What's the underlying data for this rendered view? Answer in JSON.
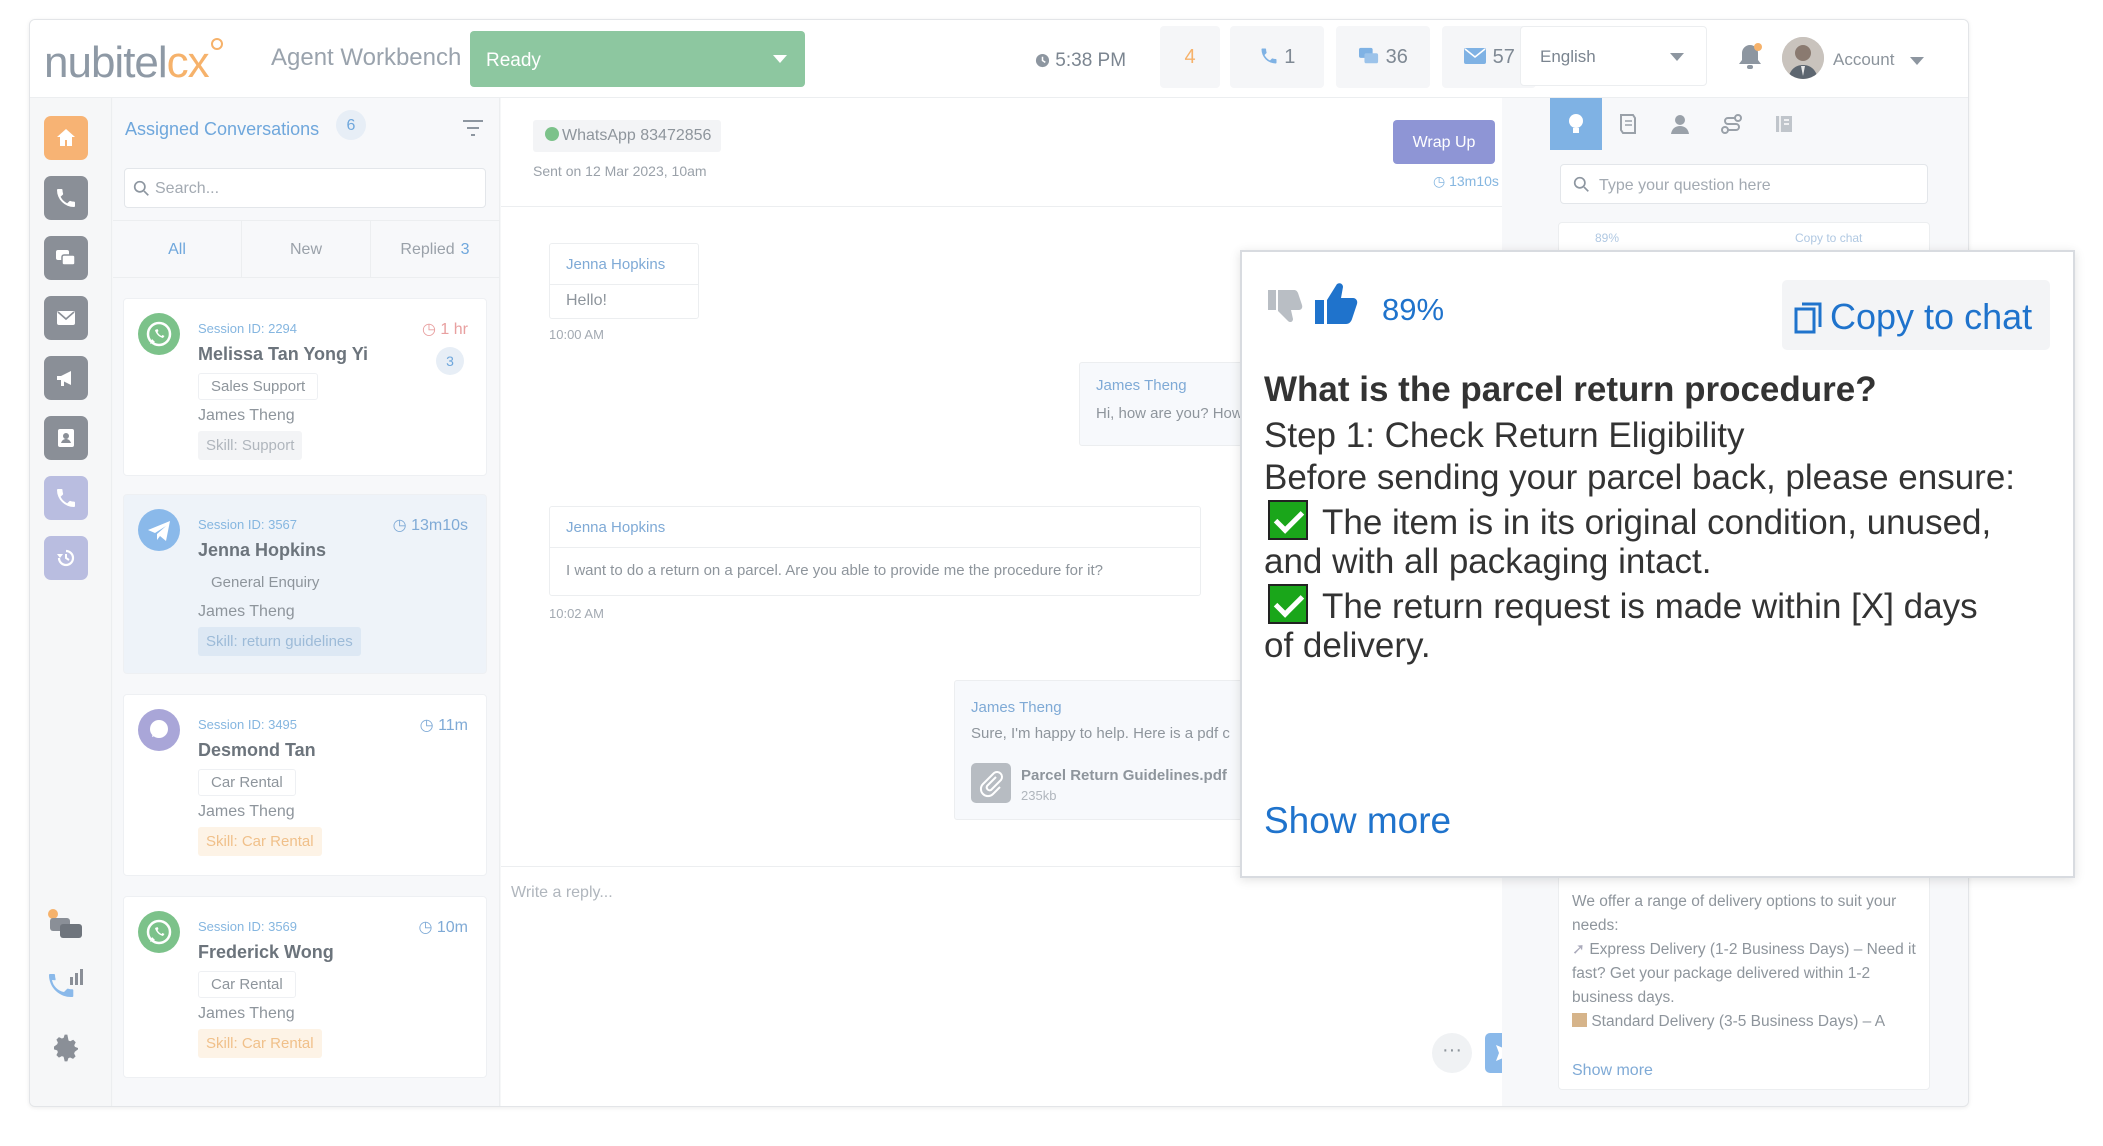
{
  "app": {
    "logo": "nubitelcx",
    "subtitle": "Agent Workbench"
  },
  "topbar": {
    "status": "Ready",
    "time": "5:38 PM",
    "queue_count": "4",
    "calls": "1",
    "chats": "36",
    "emails": "57",
    "language": "English",
    "account": "Account"
  },
  "colors": {
    "accent": "#1f73cc",
    "status_ready": "#8dc7a0",
    "home_active": "#f7b374"
  },
  "sidebar": {
    "top_icons": [
      "home-icon",
      "phone-icon",
      "chat-icon",
      "mail-icon",
      "megaphone-icon",
      "contact-card-icon",
      "call-log-icon",
      "history-icon"
    ],
    "bottom_icons": [
      "conversations-icon",
      "call-stats-icon",
      "gear-icon"
    ]
  },
  "list": {
    "title": "Assigned Conversations",
    "count": "6",
    "search_placeholder": "Search...",
    "tabs": [
      {
        "label": "All"
      },
      {
        "label": "New"
      },
      {
        "label": "Replied",
        "count": "3"
      }
    ],
    "conversations": [
      {
        "session": "Session ID: 2294",
        "name": "Melissa Tan Yong Yi",
        "dept": "Sales Support",
        "agent": "James Theng",
        "skill_label": "Skill:",
        "skill": "Support",
        "time": "1 hr",
        "badge": "3",
        "channel": "whatsapp"
      },
      {
        "session": "Session ID: 3567",
        "name": "Jenna Hopkins",
        "dept": "General Enquiry",
        "agent": "James Theng",
        "skill_label": "Skill:",
        "skill": "return guidelines",
        "time": "13m10s",
        "channel": "telegram"
      },
      {
        "session": "Session ID: 3495",
        "name": "Desmond Tan",
        "dept": "Car Rental",
        "agent": "James Theng",
        "skill_label": "Skill:",
        "skill": "Car Rental",
        "time": "11m",
        "channel": "chat"
      },
      {
        "session": "Session ID: 3569",
        "name": "Frederick Wong",
        "dept": "Car Rental",
        "agent": "James Theng",
        "skill_label": "Skill:",
        "skill": "Car Rental",
        "time": "10m",
        "channel": "whatsapp"
      }
    ]
  },
  "chat": {
    "channel": "WhatsApp 83472856",
    "sent_on": "Sent on 12 Mar 2023, 10am",
    "wrap_up": "Wrap Up",
    "wrap_timer": "13m10s",
    "messages": [
      {
        "sender": "Jenna Hopkins",
        "text": "Hello!",
        "time": "10:00 AM"
      },
      {
        "sender": "James Theng",
        "text": "Hi, how are you? How"
      },
      {
        "sender": "Jenna Hopkins",
        "text": "I want to do a return on a parcel. Are you able to provide me the procedure for it?",
        "time": "10:02 AM"
      },
      {
        "sender": "James Theng",
        "text": "Sure, I'm happy to help. Here is a pdf c",
        "attachment": "Parcel Return Guidelines.pdf",
        "attachment_size": "235kb"
      }
    ],
    "reply_placeholder": "Write a reply...",
    "more_label": "···"
  },
  "assist": {
    "search_placeholder": "Type your question here",
    "ghost_pct": "89%",
    "ghost_copy": "Copy to chat",
    "answer_text": "We offer a range of delivery options to suit your needs:",
    "express": "Express Delivery (1-2 Business Days) – Need it fast? Get your package delivered within 1-2 business days.",
    "standard": "Standard Delivery (3-5 Business Days) – A",
    "show_more": "Show more"
  },
  "popup": {
    "confidence": "89%",
    "copy_label": "Copy to chat",
    "question": "What is the parcel return procedure?",
    "lines": [
      "Step 1: Check Return Eligibility",
      "Before sending your parcel back, please ensure:",
      "The item is in its original condition, unused,",
      "and with all packaging intact.",
      "The return request is made within [X] days",
      "of delivery."
    ],
    "show_more": "Show more"
  }
}
